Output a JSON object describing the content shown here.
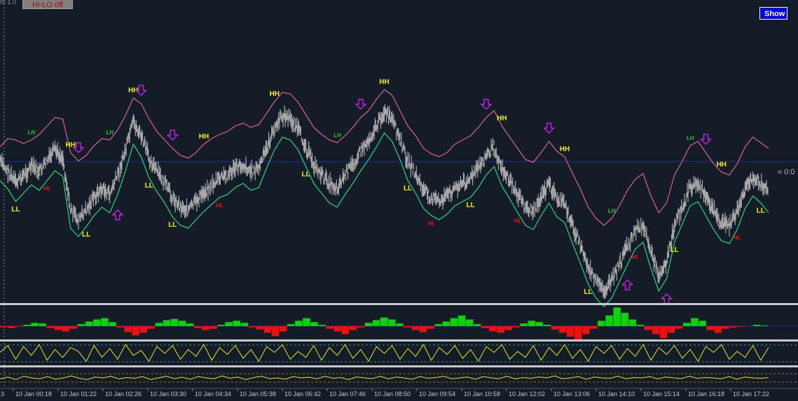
{
  "toolbar": {
    "hilo_label": "Hi-LO off",
    "show_label": "Show"
  },
  "corner_label": "85 1.0",
  "price_tag": "« 0:0",
  "colors": {
    "background": "#131c27",
    "price": "#a8a8a8",
    "upper_band": "#e0609a",
    "lower_band": "#2fd18a",
    "hh_ll": "#f5f000",
    "lh": "#18d018",
    "hl": "#ee1010",
    "arrow": "#c020e0",
    "level_line": "#2030a0",
    "osc_line": "#e8e820",
    "hist_up": "#10d010",
    "hist_down": "#ee1010"
  },
  "chart_data": {
    "type": "line",
    "x_ticks": [
      "10 Jan 00:18",
      "10 Jan 01:22",
      "10 Jan 02:26",
      "10 Jan 03:30",
      "10 Jan 04:34",
      "10 Jan 05:38",
      "10 Jan 06:42",
      "10 Jan 07:46",
      "10 Jan 08:50",
      "10 Jan 09:54",
      "10 Jan 10:58",
      "10 Jan 12:02",
      "10 Jan 13:06",
      "10 Jan 14:10",
      "10 Jan 15:14",
      "10 Jan 16:18",
      "10 Jan 17:22"
    ],
    "left_tick": "3",
    "price_series": [
      230,
      245,
      262,
      250,
      238,
      246,
      230,
      215,
      225,
      300,
      315,
      300,
      282,
      270,
      278,
      250,
      215,
      175,
      195,
      225,
      245,
      262,
      282,
      295,
      300,
      288,
      275,
      265,
      255,
      250,
      240,
      235,
      245,
      240,
      212,
      185,
      165,
      170,
      185,
      210,
      235,
      250,
      262,
      268,
      250,
      235,
      215,
      200,
      180,
      160,
      172,
      200,
      230,
      250,
      272,
      282,
      288,
      280,
      268,
      262,
      255,
      240,
      222,
      210,
      240,
      258,
      278,
      296,
      302,
      282,
      263,
      283,
      292,
      322,
      350,
      382,
      402,
      415,
      402,
      378,
      352,
      330,
      320,
      360,
      392,
      374,
      322,
      296,
      268,
      262,
      282,
      302,
      318,
      322,
      302,
      272,
      252,
      262,
      278
    ],
    "upper_band": [
      210,
      198,
      200,
      205,
      200,
      192,
      180,
      168,
      170,
      218,
      230,
      222,
      208,
      198,
      200,
      186,
      165,
      140,
      148,
      170,
      188,
      200,
      212,
      222,
      226,
      218,
      206,
      198,
      192,
      188,
      180,
      176,
      182,
      178,
      162,
      145,
      132,
      134,
      146,
      164,
      182,
      192,
      200,
      204,
      194,
      182,
      168,
      158,
      142,
      128,
      136,
      158,
      180,
      194,
      212,
      220,
      224,
      218,
      206,
      200,
      194,
      182,
      168,
      158,
      180,
      196,
      212,
      228,
      232,
      218,
      202,
      216,
      224,
      248,
      270,
      296,
      312,
      322,
      312,
      294,
      272,
      256,
      248,
      280,
      304,
      290,
      250,
      230,
      208,
      202,
      218,
      234,
      246,
      250,
      234,
      210,
      196,
      204,
      212
    ],
    "lower_band": [
      258,
      270,
      288,
      276,
      264,
      272,
      258,
      244,
      252,
      326,
      338,
      324,
      308,
      296,
      304,
      278,
      244,
      206,
      224,
      254,
      274,
      290,
      310,
      322,
      326,
      314,
      302,
      292,
      282,
      278,
      268,
      262,
      272,
      268,
      240,
      214,
      196,
      200,
      214,
      238,
      262,
      276,
      290,
      296,
      278,
      262,
      244,
      228,
      210,
      190,
      202,
      228,
      258,
      276,
      298,
      308,
      314,
      306,
      294,
      288,
      282,
      268,
      250,
      238,
      266,
      284,
      304,
      322,
      328,
      308,
      290,
      310,
      318,
      348,
      376,
      406,
      426,
      438,
      426,
      402,
      378,
      356,
      346,
      384,
      416,
      398,
      346,
      320,
      294,
      288,
      308,
      328,
      344,
      348,
      328,
      298,
      280,
      290,
      304
    ],
    "swing_labels": [
      {
        "text": "LL",
        "kind": "hh_ll",
        "i": 2
      },
      {
        "text": "LH",
        "kind": "lh",
        "i": 4
      },
      {
        "text": "HL",
        "kind": "hl",
        "i": 6
      },
      {
        "text": "HH",
        "kind": "hh_ll",
        "i": 9
      },
      {
        "text": "LL",
        "kind": "hh_ll",
        "i": 11
      },
      {
        "text": "LH",
        "kind": "lh",
        "i": 14
      },
      {
        "text": "HH",
        "kind": "hh_ll",
        "i": 17
      },
      {
        "text": "LL",
        "kind": "hh_ll",
        "i": 19
      },
      {
        "text": "LL",
        "kind": "hh_ll",
        "i": 22
      },
      {
        "text": "HH",
        "kind": "hh_ll",
        "i": 26
      },
      {
        "text": "HL",
        "kind": "hl",
        "i": 28
      },
      {
        "text": "HH",
        "kind": "hh_ll",
        "i": 35
      },
      {
        "text": "LL",
        "kind": "hh_ll",
        "i": 39
      },
      {
        "text": "LH",
        "kind": "lh",
        "i": 43
      },
      {
        "text": "HH",
        "kind": "hh_ll",
        "i": 49
      },
      {
        "text": "LL",
        "kind": "hh_ll",
        "i": 52
      },
      {
        "text": "HL",
        "kind": "hl",
        "i": 55
      },
      {
        "text": "LL",
        "kind": "hh_ll",
        "i": 60
      },
      {
        "text": "HH",
        "kind": "hh_ll",
        "i": 64
      },
      {
        "text": "HL",
        "kind": "hl",
        "i": 66
      },
      {
        "text": "HH",
        "kind": "hh_ll",
        "i": 72
      },
      {
        "text": "LL",
        "kind": "hh_ll",
        "i": 75
      },
      {
        "text": "LH",
        "kind": "lh",
        "i": 78
      },
      {
        "text": "HL",
        "kind": "hl",
        "i": 81
      },
      {
        "text": "LL",
        "kind": "hh_ll",
        "i": 86
      },
      {
        "text": "LH",
        "kind": "lh",
        "i": 88
      },
      {
        "text": "HH",
        "kind": "hh_ll",
        "i": 92
      },
      {
        "text": "HL",
        "kind": "hl",
        "i": 94
      },
      {
        "text": "LL",
        "kind": "hh_ll",
        "i": 97
      }
    ],
    "arrows": [
      {
        "dir": "down",
        "i": 10
      },
      {
        "dir": "up",
        "i": 15
      },
      {
        "dir": "down",
        "i": 18
      },
      {
        "dir": "down",
        "i": 22
      },
      {
        "dir": "down",
        "i": 46
      },
      {
        "dir": "down",
        "i": 62
      },
      {
        "dir": "down",
        "i": 70
      },
      {
        "dir": "up",
        "i": 80
      },
      {
        "dir": "up",
        "i": 85
      },
      {
        "dir": "down",
        "i": 90
      }
    ],
    "histogram": [
      -2,
      -3,
      -1,
      2,
      5,
      4,
      -3,
      -6,
      -8,
      -4,
      3,
      7,
      10,
      12,
      6,
      -2,
      -9,
      -14,
      -10,
      -4,
      5,
      9,
      11,
      8,
      4,
      -3,
      -6,
      -4,
      2,
      6,
      8,
      5,
      -2,
      -5,
      -10,
      -15,
      -8,
      3,
      8,
      12,
      6,
      2,
      -4,
      -8,
      -12,
      -6,
      -2,
      5,
      9,
      13,
      10,
      4,
      -2,
      -6,
      -9,
      -4,
      3,
      7,
      12,
      16,
      10,
      3,
      -3,
      -8,
      -10,
      -6,
      -2,
      4,
      8,
      6,
      2,
      -5,
      -10,
      -16,
      -20,
      -12,
      -4,
      8,
      16,
      28,
      20,
      10,
      2,
      -6,
      -12,
      -18,
      -10,
      -4,
      5,
      12,
      8,
      -6,
      -10,
      -4,
      -2,
      -1,
      0,
      2,
      1
    ],
    "oscillator_1": [
      0.55,
      0.9,
      0.2,
      0.85,
      0.4,
      0.95,
      0.15,
      0.7,
      0.3,
      0.8,
      0.6,
      0.1,
      0.9,
      0.3,
      0.75,
      0.2,
      0.95,
      0.4,
      0.65,
      0.1,
      0.85,
      0.5,
      0.9,
      0.2,
      0.7,
      0.35,
      0.95,
      0.15,
      0.8,
      0.45,
      0.9,
      0.25,
      0.7,
      0.1,
      0.85,
      0.55,
      0.95,
      0.2,
      0.6,
      0.3,
      0.9,
      0.15,
      0.8,
      0.4,
      0.95,
      0.25,
      0.7,
      0.1,
      0.85,
      0.5,
      0.9,
      0.2,
      0.75,
      0.35,
      0.95,
      0.15,
      0.8,
      0.45,
      0.9,
      0.25,
      0.7,
      0.1,
      0.85,
      0.55,
      0.95,
      0.2,
      0.6,
      0.3,
      0.9,
      0.15,
      0.8,
      0.4,
      0.95,
      0.25,
      0.7,
      0.1,
      0.85,
      0.5,
      0.9,
      0.2,
      0.75,
      0.35,
      0.95,
      0.15,
      0.8,
      0.45,
      0.9,
      0.25,
      0.7,
      0.1,
      0.85,
      0.55,
      0.95,
      0.2,
      0.6,
      0.3,
      0.9,
      0.15,
      0.8
    ],
    "oscillator_2": [
      0.45,
      0.55,
      0.4,
      0.6,
      0.5,
      0.45,
      0.58,
      0.42,
      0.5,
      0.62,
      0.48,
      0.4,
      0.55,
      0.5,
      0.6,
      0.44,
      0.52,
      0.48,
      0.58,
      0.4,
      0.5,
      0.6,
      0.46,
      0.54,
      0.42,
      0.58,
      0.5,
      0.45,
      0.62,
      0.48,
      0.55,
      0.4,
      0.52,
      0.6,
      0.46,
      0.5,
      0.42,
      0.58,
      0.5,
      0.54,
      0.44,
      0.6,
      0.48,
      0.52,
      0.4,
      0.56,
      0.5,
      0.46,
      0.6,
      0.44,
      0.55,
      0.5,
      0.42,
      0.58,
      0.48,
      0.52,
      0.6,
      0.45,
      0.5,
      0.55,
      0.42,
      0.58,
      0.5,
      0.46,
      0.6,
      0.44,
      0.52,
      0.48,
      0.56,
      0.5,
      0.62,
      0.45,
      0.5,
      0.58,
      0.42,
      0.55,
      0.5,
      0.48,
      0.6,
      0.45,
      0.52,
      0.5,
      0.58,
      0.44,
      0.55,
      0.5,
      0.46,
      0.6,
      0.48,
      0.52,
      0.5,
      0.45,
      0.58,
      0.42,
      0.55,
      0.5,
      0.48,
      0.52
    ]
  }
}
